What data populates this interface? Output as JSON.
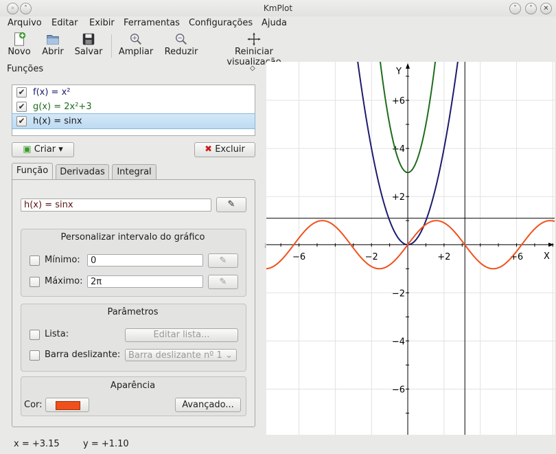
{
  "window": {
    "title": "KmPlot"
  },
  "menu": [
    "Arquivo",
    "Editar",
    "Exibir",
    "Ferramentas",
    "Configurações",
    "Ajuda"
  ],
  "toolbar": {
    "new": "Novo",
    "open": "Abrir",
    "save": "Salvar",
    "zoom_in": "Ampliar",
    "zoom_out": "Reduzir",
    "reset_view": "Reiniciar visualização"
  },
  "dock": {
    "title": "Funções"
  },
  "functions": [
    {
      "label": "f(x) = x²",
      "checked": true,
      "color": "#1b1b6e"
    },
    {
      "label": "g(x) = 2x²+3",
      "checked": true,
      "color": "#1e6b1e"
    },
    {
      "label": "h(x) = sinx",
      "checked": true,
      "color": "#f0501a",
      "selected": true
    }
  ],
  "buttons": {
    "create": "Criar",
    "delete": "Excluir"
  },
  "tabs": [
    "Função",
    "Derivadas",
    "Integral"
  ],
  "editor": {
    "equation": "h(x) = sinx"
  },
  "interval": {
    "title": "Personalizar intervalo do gráfico",
    "min_label": "Mínimo:",
    "min_value": "0",
    "max_label": "Máximo:",
    "max_value": "2π"
  },
  "parameters": {
    "title": "Parâmetros",
    "list_label": "Lista:",
    "edit_list": "Editar lista...",
    "slider_label": "Barra deslizante:",
    "slider_value": "Barra deslizante nº 1"
  },
  "appearance": {
    "title": "Aparência",
    "color_label": "Cor:",
    "color": "#f0501a",
    "advanced": "Avançado..."
  },
  "status": {
    "x": "x = +3.15",
    "y": "y = +1.10"
  },
  "plot": {
    "x_label": "X",
    "y_label": "Y",
    "x_ticks": [
      "−6",
      "−2",
      "+2",
      "+6"
    ],
    "y_ticks": [
      "+6",
      "+4",
      "+2",
      "−2",
      "−4",
      "−6"
    ]
  },
  "chart_data": {
    "type": "line",
    "title": "",
    "xlabel": "X",
    "ylabel": "Y",
    "xlim": [
      -7.8,
      8.1
    ],
    "ylim": [
      -7.9,
      7.6
    ],
    "grid": true,
    "series": [
      {
        "name": "f(x) = x²",
        "expr": "x^2",
        "color": "#1b1b6e"
      },
      {
        "name": "g(x) = 2x²+3",
        "expr": "2x^2+3",
        "color": "#1e6b1e"
      },
      {
        "name": "h(x) = sinx",
        "expr": "sin(x)",
        "color": "#f0501a"
      }
    ],
    "crosshair": {
      "x": 3.15,
      "y": 1.1
    }
  }
}
